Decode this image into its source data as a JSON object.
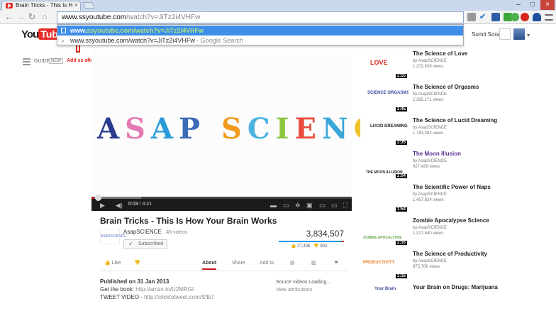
{
  "browser": {
    "tab_title": "Brain Tricks - This Is How",
    "tab_close": "×",
    "window_controls": [
      "–",
      "□",
      "×"
    ],
    "url_main": "www.ssyoutube.com",
    "url_rest": "/watch?v=JiTz2i4VHFw",
    "suggestions": [
      {
        "prefix": "www.",
        "highlight": "ssyoutube.com/watch?v=JiTz2i4VHFw"
      },
      {
        "text": "www.ssyoutube.com/watch?v=JiTz2i4VHFw",
        "suffix": " - Google Search"
      }
    ]
  },
  "header": {
    "logo_you": "You",
    "logo_tube": "Tube",
    "user_name": "Sumit Sood",
    "guide_label": "GUIDE",
    "guide_badge": "NEW"
  },
  "annotation": {
    "text": "Add ss after the dot",
    "color": "#d9251c"
  },
  "player": {
    "brand_text": "ASAP SCIENCE",
    "current_time": "0:03",
    "duration": "/ 4:41",
    "played_fraction": 0.011,
    "buffered_fraction": 0.19
  },
  "video": {
    "title": "Brain Tricks - This Is How Your Brain Works",
    "channel": "AsapSCIENCE",
    "channel_thumb": "ASAPSCIENCE",
    "video_count": "· 46 videos",
    "subscribed_label": "Subscribed",
    "view_count": "3,834,507",
    "likes": "27,405",
    "dislikes": "902",
    "like_fraction": 0.968,
    "actions": {
      "like": "Like",
      "about": "About",
      "share": "Share",
      "add_to": "Add to"
    },
    "published": "Published on 31 Jan 2013",
    "book_prefix": "Get the book: ",
    "book_link": "http://amzn.to/U2MRGI",
    "tweet_prefix": "TWEET VIDEO - ",
    "tweet_link": "http://clicktotweet.com/Sflb7",
    "source_videos": "Source videos Loading...",
    "view_attributions": "View attributions"
  },
  "related": [
    {
      "title": "The Science of Love",
      "by": "by AsapSCIENCE",
      "views": "1,272,639 views",
      "duration": "2:55",
      "visited": false
    },
    {
      "title": "The Science of Orgasms",
      "by": "by AsapSCIENCE",
      "views": "2,365,171 views",
      "duration": "2:45",
      "visited": false
    },
    {
      "title": "The Science of Lucid Dreaming",
      "by": "by AsapSCIENCE",
      "views": "1,783,382 views",
      "duration": "2:35",
      "visited": false
    },
    {
      "title": "The Moon Illusion",
      "by": "by AsapSCIENCE",
      "views": "927,426 views",
      "duration": "2:04",
      "visited": true
    },
    {
      "title": "The Scientific Power of Naps",
      "by": "by AsapSCIENCE",
      "views": "1,457,824 views",
      "duration": "1:54",
      "visited": false
    },
    {
      "title": "Zombie Apocalypse Science",
      "by": "by AsapSCIENCE",
      "views": "1,317,640 views",
      "duration": "2:16",
      "visited": false
    },
    {
      "title": "The Science of Productivity",
      "by": "by AsapSCIENCE",
      "views": "875,706 views",
      "duration": "3:16",
      "visited": false
    },
    {
      "title": "Your Brain on Drugs: Marijuana",
      "by": "",
      "views": "",
      "duration": "",
      "visited": false
    }
  ],
  "thumb_art": [
    "LOVE",
    "SCIENCE ORGASMS",
    "LUCID DREAMING",
    "THE MOON ILLUSION",
    "",
    "ZOMBIE APOCALYPSE",
    "PRODUCTIVITY",
    "Your Brain"
  ]
}
